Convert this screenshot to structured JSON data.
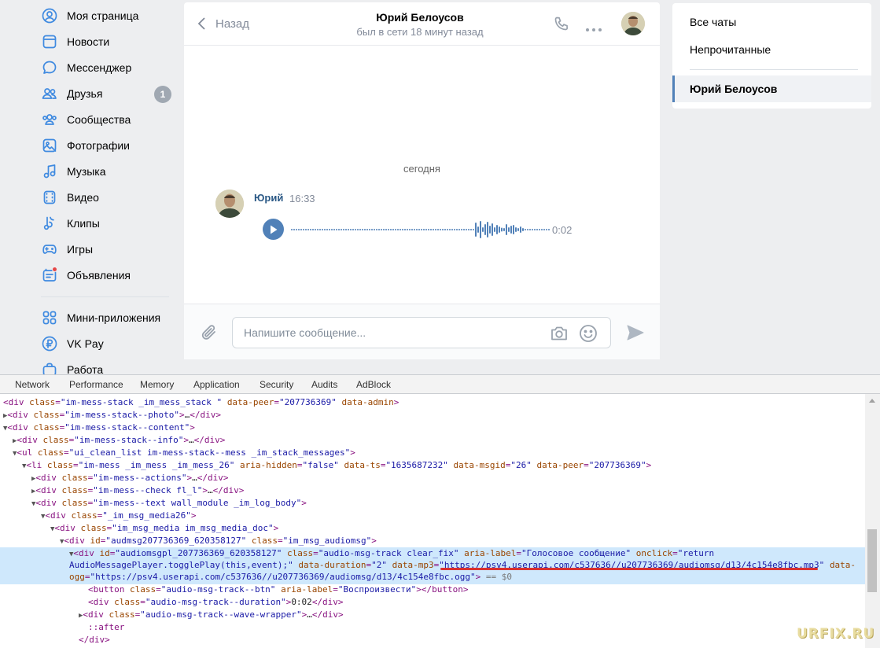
{
  "nav": {
    "items": [
      {
        "label": "Моя страница",
        "icon": "user-circle-icon"
      },
      {
        "label": "Новости",
        "icon": "newspaper-icon"
      },
      {
        "label": "Мессенджер",
        "icon": "message-bubble-icon"
      },
      {
        "label": "Друзья",
        "icon": "friends-icon",
        "badge": "1"
      },
      {
        "label": "Сообщества",
        "icon": "communities-icon"
      },
      {
        "label": "Фотографии",
        "icon": "photo-icon"
      },
      {
        "label": "Музыка",
        "icon": "music-note-icon"
      },
      {
        "label": "Видео",
        "icon": "video-icon"
      },
      {
        "label": "Клипы",
        "icon": "clips-icon"
      },
      {
        "label": "Игры",
        "icon": "gamepad-icon"
      },
      {
        "label": "Объявления",
        "icon": "classifieds-icon"
      },
      {
        "label": "Мини-приложения",
        "icon": "apps-grid-icon"
      },
      {
        "label": "VK Pay",
        "icon": "vkpay-icon"
      },
      {
        "label": "Работа",
        "icon": "briefcase-icon"
      }
    ]
  },
  "chat": {
    "back_label": "Назад",
    "peer_name": "Юрий Белоусов",
    "peer_status": "был в сети 18 минут назад",
    "date_separator": "сегодня",
    "message": {
      "author": "Юрий",
      "time": "16:33",
      "duration": "0:02"
    },
    "composer_placeholder": "Напишите сообщение..."
  },
  "right_panel": {
    "all_chats": "Все чаты",
    "unread": "Непрочитанные",
    "active_chat": "Юрий Белоусов"
  },
  "devtools": {
    "tabs": [
      "Network",
      "Performance",
      "Memory",
      "Application",
      "Security",
      "Audits",
      "AdBlock"
    ]
  },
  "watermark": "URFIX.RU",
  "colors": {
    "accent": "#5181b8",
    "link": "#2a5885",
    "icon_blue": "#3f8ae0",
    "highlight_underline": "#d9312f"
  }
}
